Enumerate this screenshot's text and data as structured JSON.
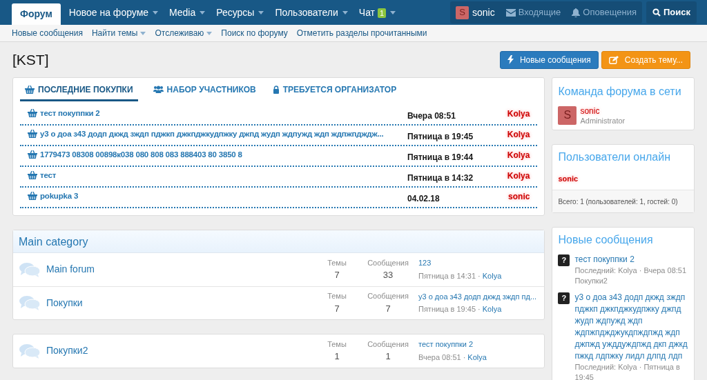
{
  "nav": {
    "tabs": [
      {
        "label": "Форум",
        "selected": true,
        "dropdown": false
      },
      {
        "label": "Новое на форуме",
        "selected": false,
        "dropdown": true
      },
      {
        "label": "Media",
        "selected": false,
        "dropdown": true
      },
      {
        "label": "Ресурсы",
        "selected": false,
        "dropdown": true
      },
      {
        "label": "Пользователи",
        "selected": false,
        "dropdown": true
      },
      {
        "label": "Чат",
        "selected": false,
        "dropdown": true,
        "badge": "1"
      }
    ],
    "user": {
      "letter": "S",
      "name": "sonic"
    },
    "inbox": "Входящие",
    "alerts": "Оповещения",
    "search": "Поиск"
  },
  "subnav": [
    {
      "label": "Новые сообщения",
      "dropdown": false
    },
    {
      "label": "Найти темы",
      "dropdown": true
    },
    {
      "label": "Отслеживаю",
      "dropdown": true
    },
    {
      "label": "Поиск по форуму",
      "dropdown": false
    },
    {
      "label": "Отметить разделы прочитанными",
      "dropdown": false
    }
  ],
  "page_title": "[KST]",
  "buttons": [
    {
      "label": "Новые сообщения",
      "kind": "primary"
    },
    {
      "label": "Создать тему...",
      "kind": "cta"
    }
  ],
  "purchases": {
    "tabs": [
      {
        "label": "ПОСЛЕДНИЕ ПОКУПКИ",
        "selected": true
      },
      {
        "label": "НАБОР УЧАСТНИКОВ",
        "selected": false
      },
      {
        "label": "ТРЕБУЕТСЯ ОРГАНИЗАТОР",
        "selected": false
      }
    ],
    "rows": [
      {
        "title": "тест покуппки 2",
        "time": "Вчера 08:51",
        "user": "Kolya"
      },
      {
        "title": "у3 о доа з43 додп дкжд зждп пджкп джкпджкудпжку джпд жудп ждпужд ждп ждпжпдждж...",
        "time": "Пятница в 19:45",
        "user": "Kolya"
      },
      {
        "title": "1779473 08308 00898к038 080 808 083 888403 80 3850 8",
        "time": "Пятница в 19:44",
        "user": "Kolya"
      },
      {
        "title": "тест",
        "time": "Пятница в 14:32",
        "user": "Kolya"
      },
      {
        "title": "pokupka 3",
        "time": "04.02.18",
        "user": "sonic"
      }
    ]
  },
  "categories": [
    {
      "title": "Main category",
      "forums": [
        {
          "name": "Main forum",
          "topics_label": "Темы",
          "topics": "7",
          "posts_label": "Сообщения",
          "posts": "33",
          "last_title": "123",
          "last_time": "Пятница в 14:31 ·",
          "last_user": "Kolya"
        },
        {
          "name": "Покупки",
          "topics_label": "Темы",
          "topics": "7",
          "posts_label": "Сообщения",
          "posts": "7",
          "last_title": "у3 о доа з43 додп дкжд зждп пд...",
          "last_time": "Пятница в 19:45 ·",
          "last_user": "Kolya"
        }
      ]
    },
    {
      "forums": [
        {
          "name": "Покупки2",
          "topics_label": "Темы",
          "topics": "1",
          "posts_label": "Сообщения",
          "posts": "1",
          "last_title": "тест покуппки 2",
          "last_time": "Вчера 08:51 ·",
          "last_user": "Kolya"
        }
      ]
    }
  ],
  "sidebar": {
    "staff": {
      "title": "Команда форума в сети",
      "members": [
        {
          "letter": "S",
          "name": "sonic",
          "role": "Administrator"
        }
      ]
    },
    "online": {
      "title": "Пользователи онлайн",
      "users": [
        "sonic"
      ],
      "footer": "Всего: 1 (пользователей: 1, гостей: 0)"
    },
    "new_posts": {
      "title": "Новые сообщения",
      "items": [
        {
          "icon": "?",
          "title": "тест покуппки 2",
          "meta": "Последний: Kolya · Вчера 08:51",
          "forum": "Покупки2"
        },
        {
          "icon": "?",
          "title": "у3 о доа з43 додп дкжд зждп пджкп джкпджкудпжку джпд жудп ждпужд ждп ждпжпджджукдпждпжд ждп джпжд ужддуждпжд дкп джкд пжкд лдпжку лидл длпд лдп",
          "meta": "Последний: Kolya · Пятница в 19:45"
        }
      ]
    }
  }
}
